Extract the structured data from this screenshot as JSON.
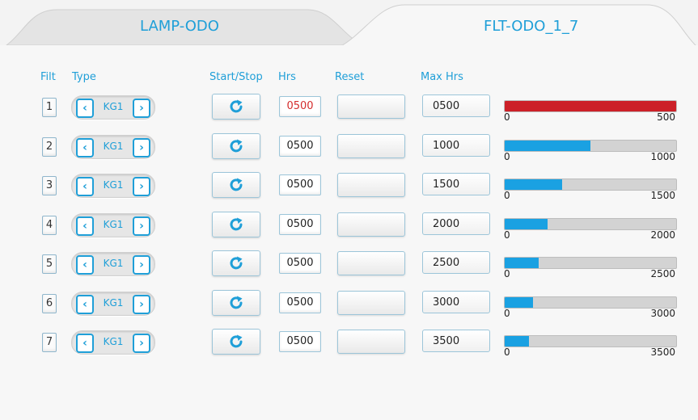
{
  "tabs": [
    {
      "label": "LAMP-ODO",
      "active": false
    },
    {
      "label": "FLT-ODO_1_7",
      "active": true
    }
  ],
  "headers": {
    "filt": "Filt",
    "type": "Type",
    "start_stop": "Start/Stop",
    "hrs": "Hrs",
    "reset": "Reset",
    "max_hrs": "Max Hrs"
  },
  "colors": {
    "accent": "#1f9fd8",
    "bar_fill": "#1aa1e2",
    "bar_full": "#cc2028",
    "alert_text": "#d42d2d"
  },
  "icons": {
    "prev": "chevron-left-icon",
    "next": "chevron-right-icon",
    "start_stop": "refresh-icon"
  },
  "rows": [
    {
      "filt": "1",
      "type": "KG1",
      "hrs": "0500",
      "max_hrs": "0500",
      "bar_min": "0",
      "bar_max": "500",
      "fraction": 1.0,
      "alert": true
    },
    {
      "filt": "2",
      "type": "KG1",
      "hrs": "0500",
      "max_hrs": "1000",
      "bar_min": "0",
      "bar_max": "1000",
      "fraction": 0.5,
      "alert": false
    },
    {
      "filt": "3",
      "type": "KG1",
      "hrs": "0500",
      "max_hrs": "1500",
      "bar_min": "0",
      "bar_max": "1500",
      "fraction": 0.3333,
      "alert": false
    },
    {
      "filt": "4",
      "type": "KG1",
      "hrs": "0500",
      "max_hrs": "2000",
      "bar_min": "0",
      "bar_max": "2000",
      "fraction": 0.25,
      "alert": false
    },
    {
      "filt": "5",
      "type": "KG1",
      "hrs": "0500",
      "max_hrs": "2500",
      "bar_min": "0",
      "bar_max": "2500",
      "fraction": 0.2,
      "alert": false
    },
    {
      "filt": "6",
      "type": "KG1",
      "hrs": "0500",
      "max_hrs": "3000",
      "bar_min": "0",
      "bar_max": "3000",
      "fraction": 0.1667,
      "alert": false
    },
    {
      "filt": "7",
      "type": "KG1",
      "hrs": "0500",
      "max_hrs": "3500",
      "bar_min": "0",
      "bar_max": "3500",
      "fraction": 0.1429,
      "alert": false
    }
  ]
}
